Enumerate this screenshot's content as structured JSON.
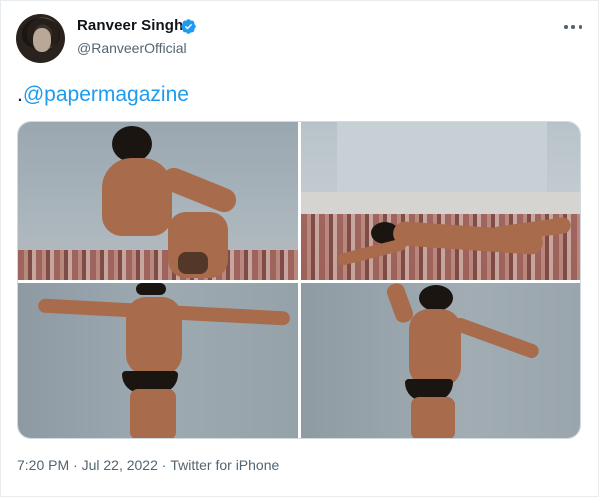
{
  "author": {
    "name": "Ranveer Singh",
    "handle": "@RanveerOfficial",
    "verified": true,
    "avatar_icon": "profile-photo"
  },
  "tweet": {
    "prefix": ".",
    "mention": "@papermagazine",
    "photos": [
      {
        "icon": "photo-seated-on-rug"
      },
      {
        "icon": "photo-lying-on-rug"
      },
      {
        "icon": "photo-standing-arms-outstretched"
      },
      {
        "icon": "photo-standing-against-wall"
      }
    ]
  },
  "meta": {
    "time": "7:20 PM",
    "separator1": " · ",
    "date": "Jul 22, 2022",
    "separator2": " · ",
    "source": "Twitter for iPhone"
  },
  "colors": {
    "link": "#1d9bf0",
    "secondary_text": "#536471",
    "verified": "#1d9bf0",
    "text": "#0f1419"
  },
  "icons": {
    "more": "more-options-icon",
    "verified": "verified-badge-icon"
  }
}
